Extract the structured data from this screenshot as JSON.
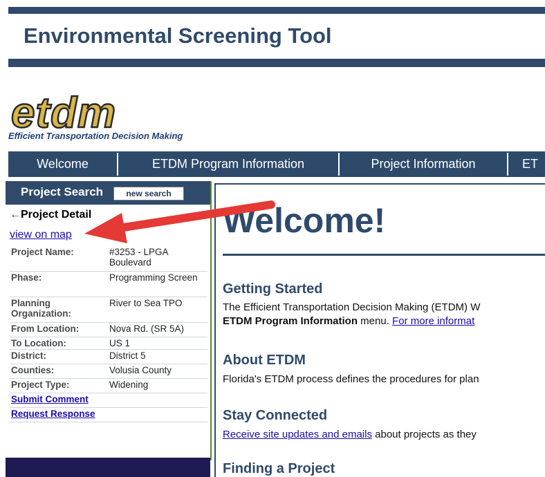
{
  "header": {
    "title": "Environmental Screening Tool"
  },
  "logo": {
    "wordmark": "etdm",
    "tagline": "Efficient Transportation Decision Making"
  },
  "nav": {
    "tabs": [
      {
        "label": "Welcome"
      },
      {
        "label": "ETDM Program Information"
      },
      {
        "label": "Project Information"
      },
      {
        "label": "ET"
      }
    ]
  },
  "sidebar": {
    "search_title": "Project Search",
    "new_search_label": "new search",
    "detail_arrow": "←",
    "detail_title": "Project Detail",
    "view_on_map": "view on map",
    "rows": [
      {
        "label": "Project Name:",
        "value": "#3253 - LPGA Boulevard"
      },
      {
        "label": "Phase:",
        "value": "Programming Screen"
      },
      {
        "label": "Planning Organization:",
        "value": "River to Sea TPO"
      },
      {
        "label": "From Location:",
        "value": "Nova Rd. (SR 5A)"
      },
      {
        "label": "To Location:",
        "value": "US 1"
      },
      {
        "label": "District:",
        "value": "District 5"
      },
      {
        "label": "Counties:",
        "value": "Volusia County"
      },
      {
        "label": "Project Type:",
        "value": "Widening"
      }
    ],
    "submit_comment": "Submit Comment",
    "request_response": "Request Response"
  },
  "main": {
    "heading": "Welcome!",
    "sections": [
      {
        "title": "Getting Started",
        "line1": "The Efficient Transportation Decision Making (ETDM) W",
        "line2_bold": "ETDM Program Information",
        "line2_text": " menu. ",
        "line2_link": "For more informat"
      },
      {
        "title": "About ETDM",
        "line1": "Florida's ETDM process defines the procedures for plan"
      },
      {
        "title": "Stay Connected",
        "link": "Receive site updates and emails",
        "text": " about projects as they"
      },
      {
        "title": "Finding a Project"
      }
    ]
  },
  "colors": {
    "brand_navy": "#2f4a6b",
    "annotation_red": "#e53935",
    "link_blue": "#1a0dab",
    "logo_gold": "#c9a227"
  }
}
